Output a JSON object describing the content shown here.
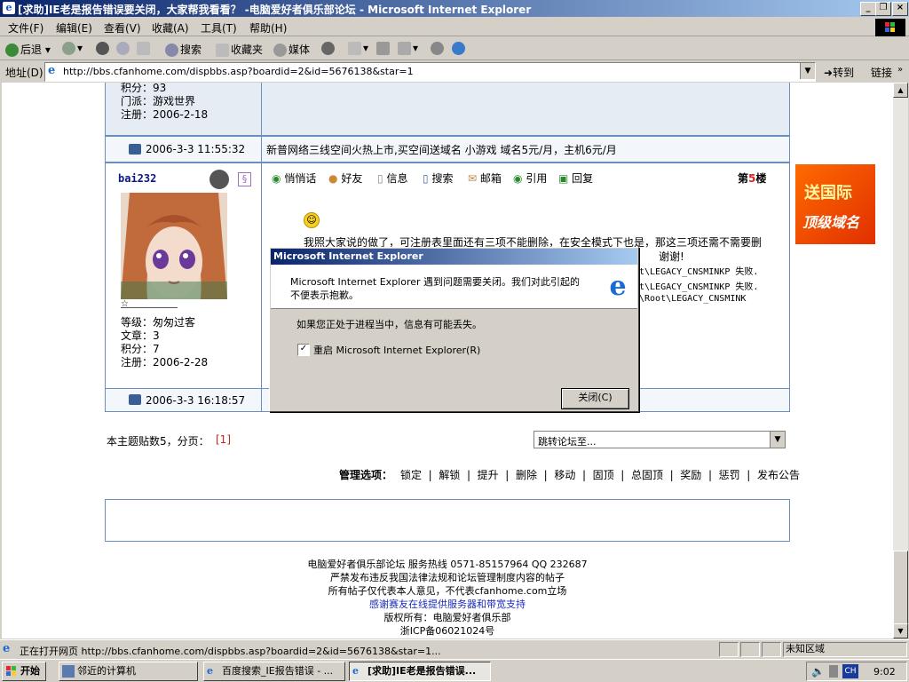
{
  "window": {
    "title": "[求助]IE老是报告错误要关闭，大家帮我看看？ -电脑爱好者俱乐部论坛 - Microsoft Internet Explorer"
  },
  "menu": [
    "文件(F)",
    "编辑(E)",
    "查看(V)",
    "收藏(A)",
    "工具(T)",
    "帮助(H)"
  ],
  "toolbar": {
    "back": "后退",
    "search": "搜索",
    "favorites": "收藏夹",
    "media": "媒体"
  },
  "address": {
    "label": "地址(D)",
    "url": "http://bbs.cfanhome.com/dispbbs.asp?boardid=2&id=5676138&star=1",
    "go": "转到",
    "links": "链接"
  },
  "post_prev": {
    "score_label": "积分：93",
    "sect": "门派：游戏世界",
    "reg": "注册：2006-2-18",
    "time": "2006-3-3 11:55:32",
    "ad": "新普网络三线空间火热上市,买空间送域名 小游戏 域名5元/月，主机6元/月"
  },
  "post5": {
    "username": "bai232",
    "level": "等级：匆匆过客",
    "posts": "文章：3",
    "score": "积分：7",
    "reg": "注册：2006-2-28",
    "actions": [
      "悄悄话",
      "好友",
      "信息",
      "搜索",
      "邮箱",
      "引用",
      "回复"
    ],
    "floor_pre": "第",
    "floor_num": "5",
    "floor_post": "楼",
    "body1": "我照大家说的做了，可注册表里面还有三项不能删除，在安全模式下也是，那这三项还需不需要删",
    "body2": "谢谢!",
    "err1": "t\\LEGACY_CNSMINKP 失败.",
    "err2": "t\\LEGACY_CNSMINKP 失败.",
    "err3": "\\Root\\LEGACY_CNSMINK",
    "time": "2006-3-3 16:18:57"
  },
  "pager": {
    "label": "本主题贴数5，分页：",
    "page": "[1]",
    "jump": "跳转论坛至..."
  },
  "admin": {
    "label": "管理选项：",
    "items": [
      "锁定",
      "解锁",
      "提升",
      "删除",
      "移动",
      "固顶",
      "总固顶",
      "奖励",
      "惩罚",
      "发布公告"
    ]
  },
  "footer": {
    "l1": "电脑爱好者俱乐部论坛 服务热线 0571-85157964 QQ 232687",
    "l2": "严禁发布违反我国法律法规和论坛管理制度内容的帖子",
    "l3": "所有帖子仅代表本人意见，不代表cfanhome.com立场",
    "l4": "感谢赛友在线提供服务器和带宽支持",
    "l5": "版权所有：电脑爱好者俱乐部",
    "l6": "浙ICP备06021024号"
  },
  "banner": {
    "line1": "送国际",
    "line2": "顶级域名"
  },
  "dialog": {
    "title": "Microsoft Internet Explorer",
    "msg1": "Microsoft Internet Explorer 遇到问题需要关闭。我们对此引起的不便表示抱歉。",
    "msg2": "如果您正处于进程当中，信息有可能丢失。",
    "restart": "重启 Microsoft Internet Explorer(R)",
    "close": "关闭(C)"
  },
  "status": {
    "text": "正在打开网页 http://bbs.cfanhome.com/dispbbs.asp?boardid=2&id=5676138&star=1...",
    "zone": "未知区域"
  },
  "taskbar": {
    "start": "开始",
    "tasks": [
      "邻近的计算机",
      "百度搜索_IE报告错误 - ...",
      "[求助]IE老是报告错误..."
    ],
    "lang": "CH",
    "clock": "9:02"
  }
}
